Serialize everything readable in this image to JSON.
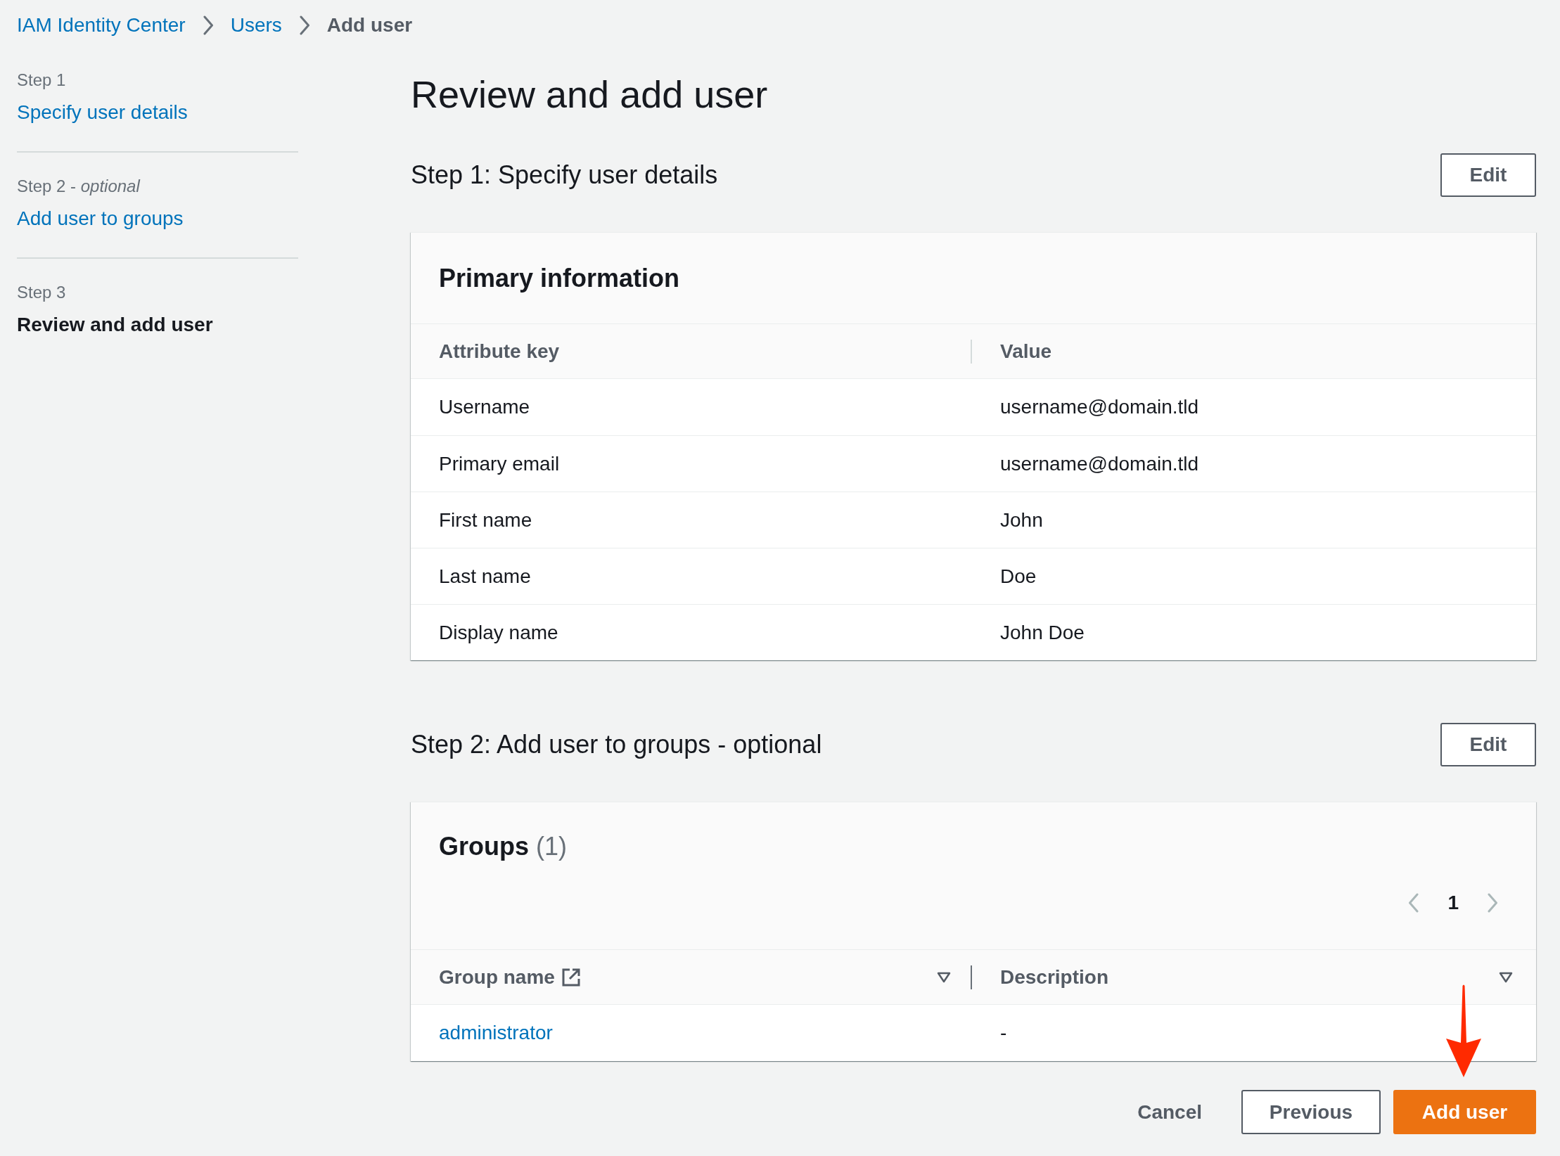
{
  "breadcrumb": [
    {
      "label": "IAM Identity Center",
      "kind": "link"
    },
    {
      "label": "Users",
      "kind": "link"
    },
    {
      "label": "Add user",
      "kind": "current"
    }
  ],
  "steps": [
    {
      "label": "Step 1",
      "title": "Specify user details",
      "selected": false
    },
    {
      "label": "Step 2 - *optional*",
      "title": "Add user to groups",
      "selected": false
    },
    {
      "label": "Step 3",
      "title": "Review and add user",
      "selected": true
    }
  ],
  "page_title": "Review and add user",
  "sections": [
    {
      "kind": "attributes",
      "heading": "Step 1: Specify user details",
      "edit_label": "Edit",
      "panel": {
        "title": "Primary information",
        "columns": [
          {
            "label": "Attribute key"
          },
          {
            "label": "Value"
          }
        ],
        "rows": [
          {
            "key": "Username",
            "value": "username@domain.tld"
          },
          {
            "key": "Primary email",
            "value": "username@domain.tld"
          },
          {
            "key": "First name",
            "value": "John"
          },
          {
            "key": "Last name",
            "value": "Doe"
          },
          {
            "key": "Display name",
            "value": "John Doe"
          }
        ]
      }
    },
    {
      "kind": "groups",
      "heading": "Step 2: Add user to groups - optional",
      "edit_label": "Edit",
      "panel": {
        "title": "Groups",
        "count": "(1)",
        "pagination": {
          "previous_disabled": true,
          "next_disabled": true,
          "pages": [
            {
              "label": "1",
              "selected": true
            }
          ]
        },
        "columns": [
          {
            "label": "Group name",
            "external_link": true,
            "sortable": true
          },
          {
            "label": "Description",
            "sortable": true
          }
        ],
        "rows": [
          {
            "group_name": "administrator",
            "description": "-"
          }
        ]
      }
    }
  ],
  "actions": [
    {
      "label": "Cancel",
      "kind": "cancel"
    },
    {
      "label": "Previous",
      "kind": "previous"
    },
    {
      "label": "Add user",
      "kind": "submit"
    }
  ]
}
